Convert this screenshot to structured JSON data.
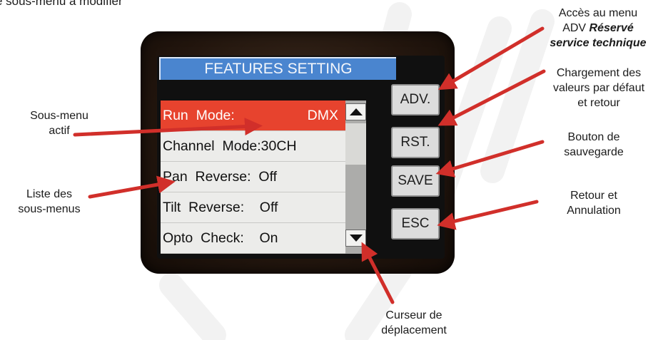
{
  "heading_fragment": "e sous-menu à modifier",
  "device": {
    "title": "FEATURES SETTING",
    "menu_items": [
      {
        "key": "Run  Mode:",
        "value": "DMX"
      },
      {
        "key": "Channel  Mode:30CH",
        "value": ""
      },
      {
        "key": "Pan  Reverse:  Off",
        "value": ""
      },
      {
        "key": "Tilt  Reverse:    Off",
        "value": ""
      },
      {
        "key": "Opto  Check:    On",
        "value": ""
      }
    ],
    "buttons": {
      "adv": "ADV.",
      "rst": "RST.",
      "save": "SAVE",
      "esc": "ESC"
    },
    "scroll": {
      "up_icon": "triangle-up-icon",
      "down_icon": "triangle-down-icon"
    }
  },
  "annotations": {
    "sous_menu_actif": [
      "Sous-menu",
      "actif"
    ],
    "liste": [
      "Liste des",
      "sous-menus"
    ],
    "adv_line1": "Accès au menu",
    "adv_line2_plain": "ADV ",
    "adv_line2_em": "Réservé",
    "adv_line3_em": "service technique",
    "rst": [
      "Chargement des",
      "valeurs par défaut",
      "et retour"
    ],
    "save": [
      "Bouton de",
      "sauvegarde"
    ],
    "esc": [
      "Retour et",
      "Annulation"
    ],
    "curseur": [
      "Curseur de",
      "déplacement"
    ]
  },
  "colors": {
    "arrow": "#d12f2a",
    "title_bar": "#4a85cf",
    "active_row": "#e7432e",
    "watermark": "#f0f0f0"
  }
}
